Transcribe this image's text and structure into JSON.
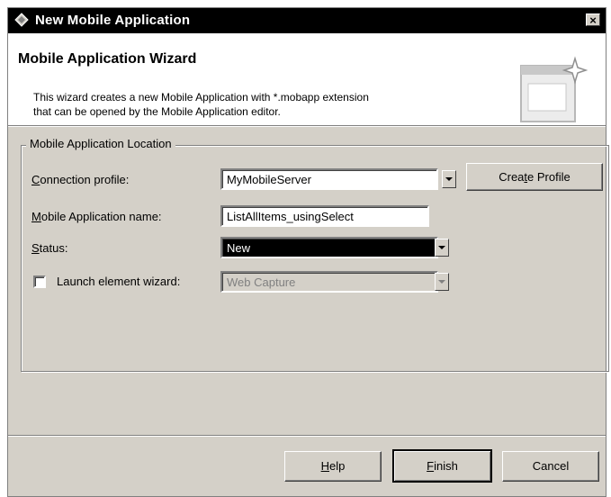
{
  "window": {
    "title": "New Mobile Application",
    "close_glyph": "×"
  },
  "banner": {
    "title": "Mobile Application Wizard",
    "desc_line1": "This wizard creates a new Mobile Application with *.mobapp extension",
    "desc_line2": "that can be opened by the Mobile Application editor."
  },
  "group": {
    "legend": "Mobile Application Location"
  },
  "form": {
    "connection_profile": {
      "label_pre": "",
      "label_key": "C",
      "label_post": "onnection profile:",
      "value": "MyMobileServer"
    },
    "app_name": {
      "label_pre": "",
      "label_key": "M",
      "label_post": "obile Application name:",
      "value": "ListAllItems_usingSelect"
    },
    "status": {
      "label_pre": "",
      "label_key": "S",
      "label_post": "tatus:",
      "value": "New"
    },
    "launch_wizard": {
      "label": "Launch element wizard:",
      "value": "Web Capture",
      "checked": false
    }
  },
  "buttons": {
    "create_profile": {
      "pre": "Crea",
      "key": "t",
      "post": "e Profile"
    },
    "help": {
      "pre": "",
      "key": "H",
      "post": "elp"
    },
    "finish": {
      "pre": "",
      "key": "F",
      "post": "inish"
    },
    "cancel": {
      "label": "Cancel"
    }
  },
  "colors": {
    "titlebar": "#000000",
    "dialog": "#d4d0c8",
    "selection": "#000000"
  },
  "icons": {
    "title": "wizard-diamond-icon",
    "banner": "window-sparkle-icon",
    "dropdown": "chevron-down-icon"
  }
}
